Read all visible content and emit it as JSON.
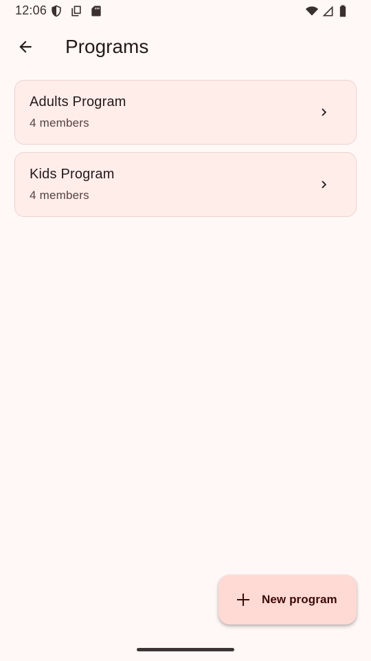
{
  "status_bar": {
    "time": "12:06",
    "left_icons": [
      "shield-icon",
      "copy-icon",
      "sd-card-icon"
    ],
    "right_icons": [
      "wifi-icon",
      "cell-signal-icon",
      "battery-icon"
    ]
  },
  "app_bar": {
    "back_icon": "arrow-left-icon",
    "title": "Programs"
  },
  "programs": [
    {
      "name": "Adults Program",
      "members": "4 members"
    },
    {
      "name": "Kids Program",
      "members": "4 members"
    }
  ],
  "fab": {
    "icon": "plus-icon",
    "label": "New program"
  },
  "colors": {
    "background": "#fff8f7",
    "card": "#ffedea",
    "fab": "#ffdad5"
  }
}
